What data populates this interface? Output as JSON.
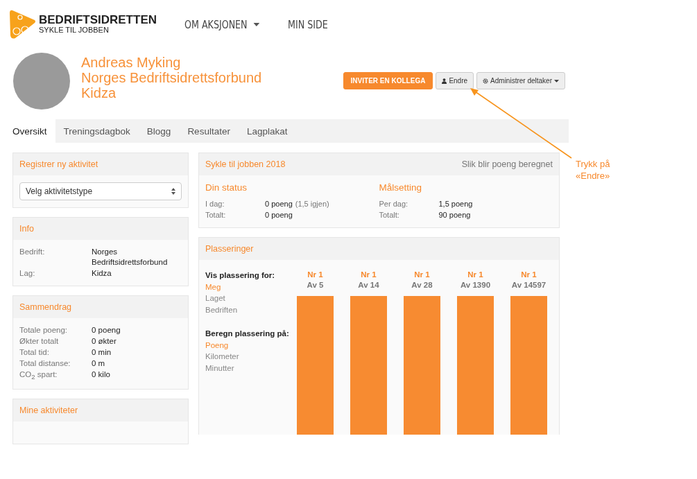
{
  "brand": {
    "title": "BEDRIFTSIDRETTEN",
    "subtitle": "SYKLE TIL JOBBEN"
  },
  "nav": [
    {
      "label": "OM AKSJONEN",
      "dropdown": true
    },
    {
      "label": "MIN SIDE",
      "dropdown": false
    }
  ],
  "profile": {
    "name": "Andreas Myking",
    "company": "Norges Bedriftsidrettsforbund",
    "team": "Kidza"
  },
  "actions": [
    {
      "kind": "primary",
      "label": "INVITER EN KOLLEGA"
    },
    {
      "kind": "user",
      "label": "Endre"
    },
    {
      "kind": "gear",
      "label": "Administrer deltaker"
    }
  ],
  "tabs": [
    {
      "label": "Oversikt",
      "selected": true
    },
    {
      "label": "Treningsdagbok",
      "selected": false
    },
    {
      "label": "Blogg",
      "selected": false
    },
    {
      "label": "Resultater",
      "selected": false
    },
    {
      "label": "Lagplakat",
      "selected": false
    }
  ],
  "register": {
    "title": "Registrer ny aktivitet",
    "select": "Velg aktivitetstype"
  },
  "info": {
    "title": "Info",
    "rows": [
      {
        "label": "Bedrift:",
        "value": "Norges Bedriftsidrettsforbund"
      },
      {
        "label": "Lag:",
        "value": "Kidza"
      }
    ]
  },
  "summary": {
    "title": "Sammendrag",
    "rows": [
      {
        "label": "Totale poeng:",
        "value": "0 poeng"
      },
      {
        "label": "Økter totalt",
        "value": "0 økter"
      },
      {
        "label": "Total tid:",
        "value": "0 min"
      },
      {
        "label": "Total distanse:",
        "value": "0 m"
      },
      {
        "label": "CO$_{2}$ spart:",
        "value": "0 kilo"
      }
    ]
  },
  "activities": {
    "title": "Mine aktiviteter"
  },
  "campaign": {
    "title": "Sykle til jobben 2018",
    "link": "Slik blir poeng beregnet",
    "status": {
      "title": "Din status",
      "rows": [
        {
          "label": "I dag:",
          "value": "0 poeng",
          "note": "(1,5 igjen)"
        },
        {
          "label": "Totalt:",
          "value": "0 poeng"
        }
      ]
    },
    "goal": {
      "title": "Målsetting",
      "rows": [
        {
          "label": "Per dag:",
          "value": "1,5 poeng"
        },
        {
          "label": "Totalt:",
          "value": "90 poeng"
        }
      ]
    }
  },
  "rankings": {
    "title": "Plasseringer",
    "groups": [
      {
        "heading": "Vis plassering for:",
        "options": [
          {
            "label": "Meg",
            "selected": true
          },
          {
            "label": "Laget",
            "selected": false
          },
          {
            "label": "Bedriften",
            "selected": false
          }
        ]
      },
      {
        "heading": "Beregn plassering på:",
        "options": [
          {
            "label": "Poeng",
            "selected": true
          },
          {
            "label": "Kilometer",
            "selected": false
          },
          {
            "label": "Minutter",
            "selected": false
          }
        ]
      }
    ],
    "places": [
      {
        "rank": "Nr 1",
        "of": "Av 5"
      },
      {
        "rank": "Nr 1",
        "of": "Av 14"
      },
      {
        "rank": "Nr 1",
        "of": "Av 28"
      },
      {
        "rank": "Nr 1",
        "of": "Av 1390"
      },
      {
        "rank": "Nr 1",
        "of": "Av 14597"
      }
    ]
  },
  "annotation": {
    "text": "Trykk på «Endre»"
  }
}
